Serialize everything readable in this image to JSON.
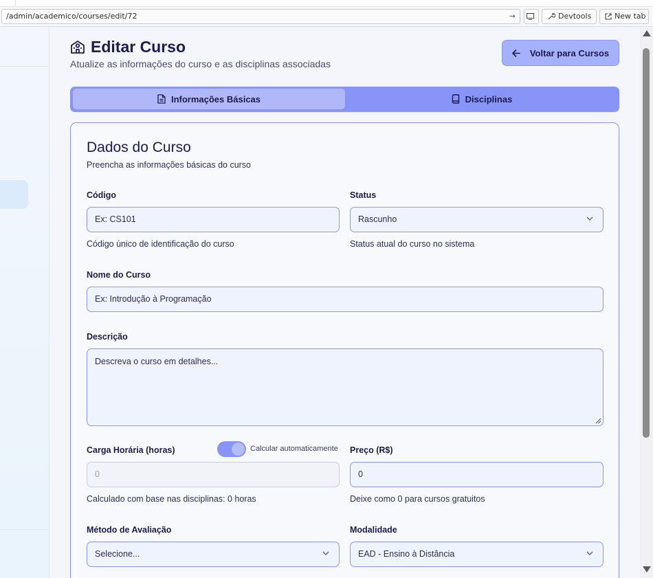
{
  "browser": {
    "url": "/admin/academico/courses/edit/72",
    "go_icon": "arrow-right-icon",
    "devtools_label": "Devtools",
    "newtab_label": "New tab"
  },
  "header": {
    "title": "Editar Curso",
    "subtitle": "Atualize as informações do curso e as disciplinas associadas",
    "back_label": "Voltar para Cursos"
  },
  "tabs": [
    {
      "label": "Informações Básicas",
      "icon": "document-icon",
      "active": true
    },
    {
      "label": "Disciplinas",
      "icon": "book-icon",
      "active": false
    }
  ],
  "form": {
    "title": "Dados do Curso",
    "subtitle": "Preencha as informações básicas do curso",
    "codigo": {
      "label": "Código",
      "placeholder": "Ex: CS101",
      "help": "Código único de identificação do curso"
    },
    "status": {
      "label": "Status",
      "value": "Rascunho",
      "help": "Status atual do curso no sistema"
    },
    "nome": {
      "label": "Nome do Curso",
      "placeholder": "Ex: Introdução à Programação"
    },
    "descricao": {
      "label": "Descrição",
      "placeholder": "Descreva o curso em detalhes..."
    },
    "carga": {
      "label": "Carga Horária (horas)",
      "toggle_label": "Calcular automaticamente",
      "toggle_on": true,
      "value": "0",
      "help": "Calculado com base nas disciplinas: 0 horas"
    },
    "preco": {
      "label": "Preço (R$)",
      "value": "0",
      "help": "Deixe como 0 para cursos gratuitos"
    },
    "metodo": {
      "label": "Método de Avaliação",
      "value": "Selecione..."
    },
    "modalidade": {
      "label": "Modalidade",
      "value": "EAD - Ensino à Distância"
    }
  },
  "colors": {
    "accent": "#8894f7",
    "accent_light": "#a5b1fb",
    "text": "#1e1b4b"
  }
}
